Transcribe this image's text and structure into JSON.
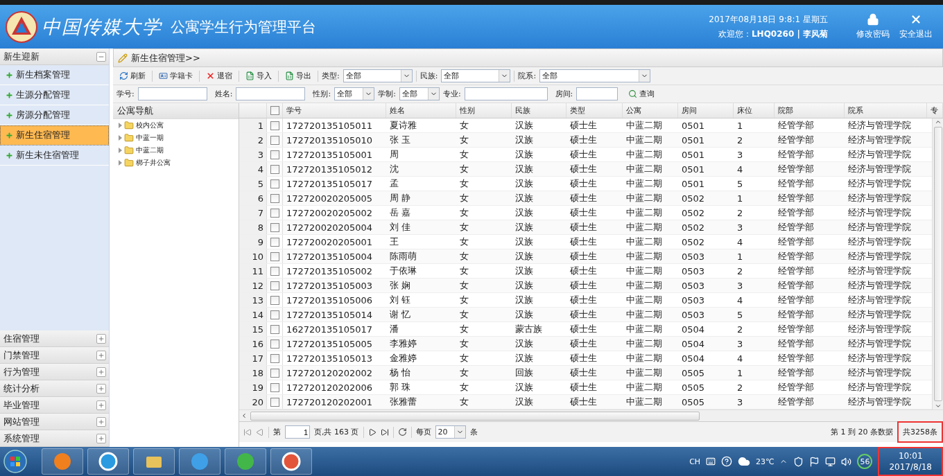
{
  "header": {
    "logo_text": "中国传媒大学",
    "title": "公寓学生行为管理平台",
    "datetime": "2017年08月18日 9:8:1 星期五",
    "welcome": "欢迎您：**LHQ0260 | 李风菊**",
    "actions": [
      {
        "label": "修改密码",
        "kind": "lock"
      },
      {
        "label": "安全退出",
        "kind": "close"
      }
    ]
  },
  "sidebar": {
    "sections": [
      {
        "label": "新生迎新",
        "expanded": true,
        "items": [
          {
            "label": "新生档案管理",
            "selected": false
          },
          {
            "label": "生源分配管理",
            "selected": false
          },
          {
            "label": "房源分配管理",
            "selected": false
          },
          {
            "label": "新生住宿管理",
            "selected": true
          },
          {
            "label": "新生未住宿管理",
            "selected": false
          }
        ]
      },
      {
        "label": "住宿管理",
        "expanded": false
      },
      {
        "label": "门禁管理",
        "expanded": false
      },
      {
        "label": "行为管理",
        "expanded": false
      },
      {
        "label": "统计分析",
        "expanded": false
      },
      {
        "label": "毕业管理",
        "expanded": false
      },
      {
        "label": "网站管理",
        "expanded": false
      },
      {
        "label": "系统管理",
        "expanded": false
      }
    ]
  },
  "breadcrumb": "新生住宿管理>>",
  "toolbar": {
    "buttons": [
      {
        "label": "刷新",
        "kind": "refresh"
      },
      {
        "label": "学籍卡",
        "kind": "card"
      },
      {
        "label": "退宿",
        "kind": "delete"
      },
      {
        "label": "导入",
        "kind": "import"
      },
      {
        "label": "导出",
        "kind": "export"
      }
    ],
    "filters": [
      {
        "label": "类型:",
        "value": "全部"
      },
      {
        "label": "民族:",
        "value": "全部"
      },
      {
        "label": "院系:",
        "value": "全部"
      }
    ]
  },
  "search": {
    "fields": [
      {
        "label": "学号:",
        "kind": "input"
      },
      {
        "label": "姓名:",
        "kind": "input"
      },
      {
        "label": "性别:",
        "kind": "select",
        "value": "全部"
      },
      {
        "label": "学制:",
        "kind": "select",
        "value": "全部"
      },
      {
        "label": "专业:",
        "kind": "input"
      },
      {
        "label": "房间:",
        "kind": "input"
      }
    ],
    "button": "查询"
  },
  "tree": {
    "title": "公寓导航",
    "nodes": [
      {
        "label": "校内公寓",
        "expanded": false
      },
      {
        "label": "中蓝一期",
        "expanded": false
      },
      {
        "label": "中蓝二期",
        "expanded": false
      },
      {
        "label": "梆子井公寓",
        "expanded": false
      }
    ]
  },
  "grid": {
    "header_checked": false,
    "columns": [
      "学号",
      "姓名",
      "性别",
      "民族",
      "类型",
      "公寓",
      "房间",
      "床位",
      "院部",
      "院系",
      "专"
    ],
    "rows": [
      {
        "num": "1",
        "checked": false,
        "cells": [
          "172720135105011",
          "夏诗雅",
          "女",
          "汉族",
          "硕士生",
          "中蓝二期",
          "0501",
          "1",
          "经管学部",
          "经济与管理学院"
        ]
      },
      {
        "num": "2",
        "checked": false,
        "cells": [
          "172720135105010",
          "张 玉",
          "女",
          "汉族",
          "硕士生",
          "中蓝二期",
          "0501",
          "2",
          "经管学部",
          "经济与管理学院"
        ]
      },
      {
        "num": "3",
        "checked": false,
        "cells": [
          "172720135105001",
          "周",
          "女",
          "汉族",
          "硕士生",
          "中蓝二期",
          "0501",
          "3",
          "经管学部",
          "经济与管理学院"
        ]
      },
      {
        "num": "4",
        "checked": false,
        "cells": [
          "172720135105012",
          "沈",
          "女",
          "汉族",
          "硕士生",
          "中蓝二期",
          "0501",
          "4",
          "经管学部",
          "经济与管理学院"
        ]
      },
      {
        "num": "5",
        "checked": false,
        "cells": [
          "172720135105017",
          "孟",
          "女",
          "汉族",
          "硕士生",
          "中蓝二期",
          "0501",
          "5",
          "经管学部",
          "经济与管理学院"
        ]
      },
      {
        "num": "6",
        "checked": false,
        "cells": [
          "172720020205005",
          "周 静",
          "女",
          "汉族",
          "硕士生",
          "中蓝二期",
          "0502",
          "1",
          "经管学部",
          "经济与管理学院"
        ]
      },
      {
        "num": "7",
        "checked": false,
        "cells": [
          "172720020205002",
          "岳 嘉",
          "女",
          "汉族",
          "硕士生",
          "中蓝二期",
          "0502",
          "2",
          "经管学部",
          "经济与管理学院"
        ]
      },
      {
        "num": "8",
        "checked": false,
        "cells": [
          "172720020205004",
          "刘 佳",
          "女",
          "汉族",
          "硕士生",
          "中蓝二期",
          "0502",
          "3",
          "经管学部",
          "经济与管理学院"
        ]
      },
      {
        "num": "9",
        "checked": false,
        "cells": [
          "172720020205001",
          "王",
          "女",
          "汉族",
          "硕士生",
          "中蓝二期",
          "0502",
          "4",
          "经管学部",
          "经济与管理学院"
        ]
      },
      {
        "num": "10",
        "checked": false,
        "cells": [
          "172720135105004",
          "陈雨萌",
          "女",
          "汉族",
          "硕士生",
          "中蓝二期",
          "0503",
          "1",
          "经管学部",
          "经济与管理学院"
        ]
      },
      {
        "num": "11",
        "checked": false,
        "cells": [
          "172720135105002",
          "于依琳",
          "女",
          "汉族",
          "硕士生",
          "中蓝二期",
          "0503",
          "2",
          "经管学部",
          "经济与管理学院"
        ]
      },
      {
        "num": "12",
        "checked": false,
        "cells": [
          "172720135105003",
          "张 娴",
          "女",
          "汉族",
          "硕士生",
          "中蓝二期",
          "0503",
          "3",
          "经管学部",
          "经济与管理学院"
        ]
      },
      {
        "num": "13",
        "checked": false,
        "cells": [
          "172720135105006",
          "刘 钰",
          "女",
          "汉族",
          "硕士生",
          "中蓝二期",
          "0503",
          "4",
          "经管学部",
          "经济与管理学院"
        ]
      },
      {
        "num": "14",
        "checked": false,
        "cells": [
          "172720135105014",
          "谢 忆",
          "女",
          "汉族",
          "硕士生",
          "中蓝二期",
          "0503",
          "5",
          "经管学部",
          "经济与管理学院"
        ]
      },
      {
        "num": "15",
        "checked": false,
        "cells": [
          "162720135105017",
          "潘",
          "女",
          "蒙古族",
          "硕士生",
          "中蓝二期",
          "0504",
          "2",
          "经管学部",
          "经济与管理学院"
        ]
      },
      {
        "num": "16",
        "checked": false,
        "cells": [
          "172720135105005",
          "李雅婷",
          "女",
          "汉族",
          "硕士生",
          "中蓝二期",
          "0504",
          "3",
          "经管学部",
          "经济与管理学院"
        ]
      },
      {
        "num": "17",
        "checked": false,
        "cells": [
          "172720135105013",
          "金雅婷",
          "女",
          "汉族",
          "硕士生",
          "中蓝二期",
          "0504",
          "4",
          "经管学部",
          "经济与管理学院"
        ]
      },
      {
        "num": "18",
        "checked": false,
        "cells": [
          "172720120202002",
          "杨 怡",
          "女",
          "回族",
          "硕士生",
          "中蓝二期",
          "0505",
          "1",
          "经管学部",
          "经济与管理学院"
        ]
      },
      {
        "num": "19",
        "checked": false,
        "cells": [
          "172720120202006",
          "郭 珠",
          "女",
          "汉族",
          "硕士生",
          "中蓝二期",
          "0505",
          "2",
          "经管学部",
          "经济与管理学院"
        ]
      },
      {
        "num": "20",
        "checked": false,
        "cells": [
          "172720120202001",
          "张雅蕾",
          "女",
          "汉族",
          "硕士生",
          "中蓝二期",
          "0505",
          "3",
          "经管学部",
          "经济与管理学院"
        ]
      }
    ]
  },
  "pager": {
    "page_prefix": "第",
    "page": "1",
    "page_suffix": "页,共 163 页",
    "per_page_label": "每页",
    "per_page": "20",
    "per_page_unit": "条",
    "info": "第 1 到 20 条数据",
    "total": "共3258条"
  },
  "taskbar": {
    "apps": [
      {
        "kind": "browser"
      },
      {
        "kind": "circle"
      },
      {
        "kind": "folder"
      },
      {
        "kind": "ie"
      },
      {
        "kind": "chat"
      },
      {
        "kind": "ring"
      }
    ],
    "language": "CH",
    "temperature": "23℃",
    "badge": "56",
    "time": "10:01",
    "date": "2017/8/18"
  }
}
